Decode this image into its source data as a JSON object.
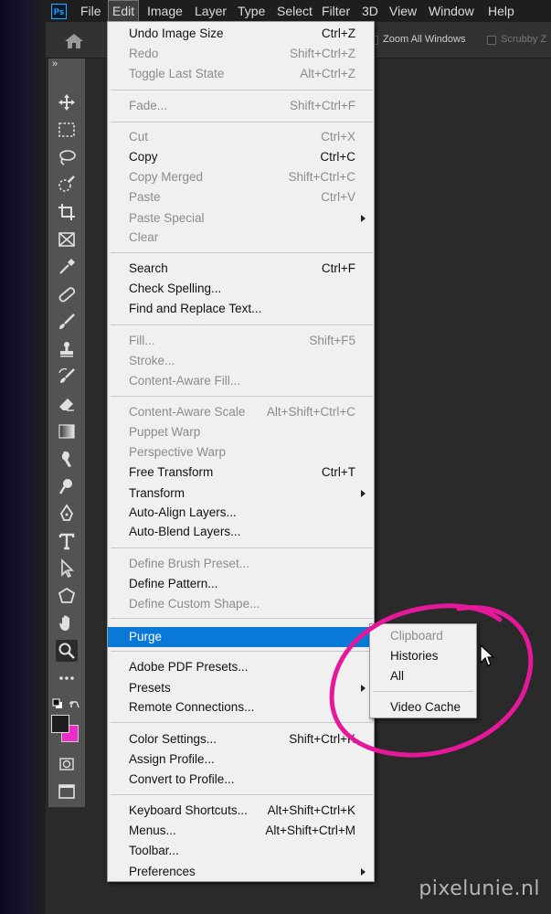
{
  "app": {
    "logo_text": "Ps",
    "brand_color": "#31a8ff"
  },
  "menubar": {
    "items": [
      "File",
      "Edit",
      "Image",
      "Layer",
      "Type",
      "Select",
      "Filter",
      "3D",
      "View",
      "Window",
      "Help"
    ],
    "active": "Edit"
  },
  "options_bar": {
    "home_icon": "home-icon",
    "zoom_all_windows": {
      "label": "Zoom All Windows",
      "checked": false
    },
    "scrubby_zoom": {
      "label": "Scrubby Z"
    }
  },
  "toolbar": {
    "collapse": "»",
    "tools": [
      "move-icon",
      "marquee-icon",
      "lasso-icon",
      "quick-select-icon",
      "crop-icon",
      "frame-icon",
      "eyedropper-icon",
      "healing-icon",
      "brush-icon",
      "stamp-icon",
      "history-brush-icon",
      "eraser-icon",
      "gradient-icon",
      "smudge-icon",
      "dodge-icon",
      "pen-icon",
      "type-icon",
      "path-select-icon",
      "shape-icon",
      "hand-icon",
      "zoom-icon",
      "more-tools-icon"
    ],
    "selected_tool": "zoom-icon",
    "foreground_color": "#1e1e1e",
    "background_color": "#ea2ec9"
  },
  "edit_menu": {
    "items": [
      {
        "label": "Undo Image Size",
        "shortcut": "Ctrl+Z",
        "enabled": true
      },
      {
        "label": "Redo",
        "shortcut": "Shift+Ctrl+Z",
        "enabled": false
      },
      {
        "label": "Toggle Last State",
        "shortcut": "Alt+Ctrl+Z",
        "enabled": false
      },
      {
        "label": "Fade...",
        "shortcut": "Shift+Ctrl+F",
        "enabled": false
      },
      {
        "label": "Cut",
        "shortcut": "Ctrl+X",
        "enabled": false
      },
      {
        "label": "Copy",
        "shortcut": "Ctrl+C",
        "enabled": true
      },
      {
        "label": "Copy Merged",
        "shortcut": "Shift+Ctrl+C",
        "enabled": false
      },
      {
        "label": "Paste",
        "shortcut": "Ctrl+V",
        "enabled": false
      },
      {
        "label": "Paste Special",
        "shortcut": "",
        "enabled": false,
        "submenu": true
      },
      {
        "label": "Clear",
        "shortcut": "",
        "enabled": false
      },
      {
        "label": "Search",
        "shortcut": "Ctrl+F",
        "enabled": true
      },
      {
        "label": "Check Spelling...",
        "shortcut": "",
        "enabled": true
      },
      {
        "label": "Find and Replace Text...",
        "shortcut": "",
        "enabled": true
      },
      {
        "label": "Fill...",
        "shortcut": "Shift+F5",
        "enabled": false
      },
      {
        "label": "Stroke...",
        "shortcut": "",
        "enabled": false
      },
      {
        "label": "Content-Aware Fill...",
        "shortcut": "",
        "enabled": false
      },
      {
        "label": "Content-Aware Scale",
        "shortcut": "Alt+Shift+Ctrl+C",
        "enabled": false
      },
      {
        "label": "Puppet Warp",
        "shortcut": "",
        "enabled": false
      },
      {
        "label": "Perspective Warp",
        "shortcut": "",
        "enabled": false
      },
      {
        "label": "Free Transform",
        "shortcut": "Ctrl+T",
        "enabled": true
      },
      {
        "label": "Transform",
        "shortcut": "",
        "enabled": true,
        "submenu": true
      },
      {
        "label": "Auto-Align Layers...",
        "shortcut": "",
        "enabled": true
      },
      {
        "label": "Auto-Blend Layers...",
        "shortcut": "",
        "enabled": true
      },
      {
        "label": "Define Brush Preset...",
        "shortcut": "",
        "enabled": false
      },
      {
        "label": "Define Pattern...",
        "shortcut": "",
        "enabled": true
      },
      {
        "label": "Define Custom Shape...",
        "shortcut": "",
        "enabled": false
      },
      {
        "label": "Purge",
        "shortcut": "",
        "enabled": true,
        "submenu": true,
        "highlighted": true
      },
      {
        "label": "Adobe PDF Presets...",
        "shortcut": "",
        "enabled": true
      },
      {
        "label": "Presets",
        "shortcut": "",
        "enabled": true,
        "submenu": true
      },
      {
        "label": "Remote Connections...",
        "shortcut": "",
        "enabled": true
      },
      {
        "label": "Color Settings...",
        "shortcut": "Shift+Ctrl+K",
        "enabled": true
      },
      {
        "label": "Assign Profile...",
        "shortcut": "",
        "enabled": true
      },
      {
        "label": "Convert to Profile...",
        "shortcut": "",
        "enabled": true
      },
      {
        "label": "Keyboard Shortcuts...",
        "shortcut": "Alt+Shift+Ctrl+K",
        "enabled": true
      },
      {
        "label": "Menus...",
        "shortcut": "Alt+Shift+Ctrl+M",
        "enabled": true
      },
      {
        "label": "Toolbar...",
        "shortcut": "",
        "enabled": true
      },
      {
        "label": "Preferences",
        "shortcut": "",
        "enabled": true,
        "submenu": true
      }
    ]
  },
  "purge_submenu": {
    "items": [
      {
        "label": "Clipboard",
        "enabled": false
      },
      {
        "label": "Histories",
        "enabled": true
      },
      {
        "label": "All",
        "enabled": true
      },
      {
        "label": "Video Cache",
        "enabled": true
      }
    ]
  },
  "annotation": {
    "color": "#e6189a"
  },
  "watermark": "pixelunie.nl"
}
